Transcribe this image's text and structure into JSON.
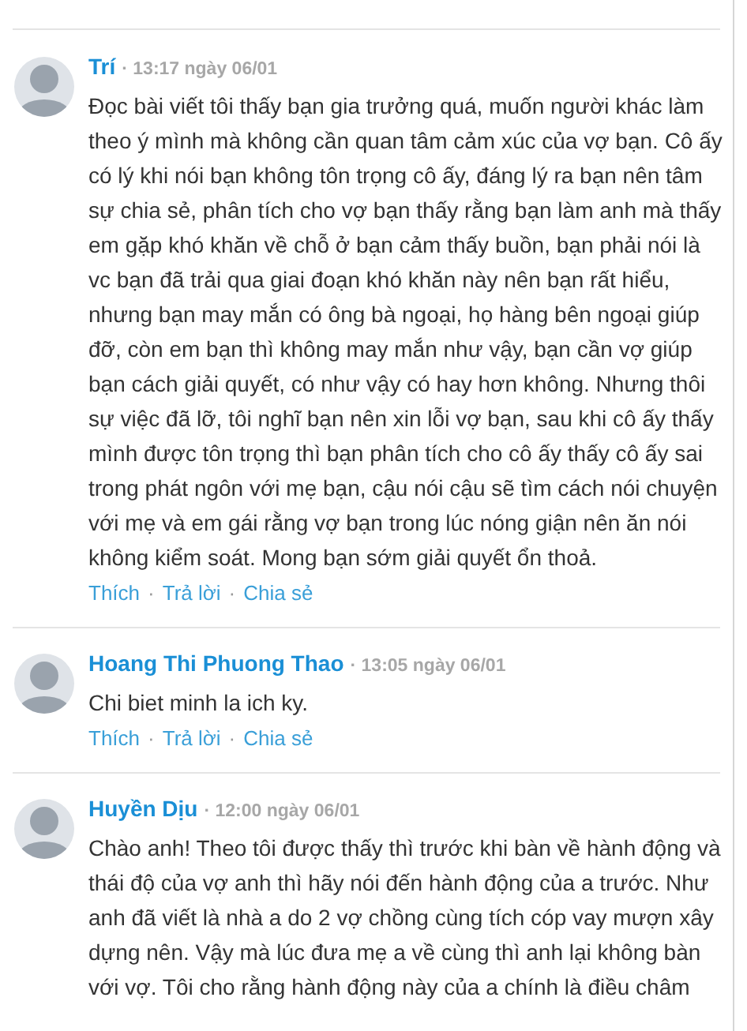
{
  "comments": [
    {
      "author": "Trí",
      "time": "13:17 ngày 06/01",
      "text": "Đọc bài viết tôi thấy bạn gia trưởng quá, muốn người khác làm\ntheo ý mình mà không cần quan tâm cảm xúc của vợ bạn. Cô ấy\ncó lý khi nói bạn không tôn trọng cô ấy, đáng lý ra bạn nên tâm\nsự chia sẻ, phân tích cho vợ bạn thấy rằng bạn làm anh mà thấy\nem gặp khó khăn về chỗ ở bạn cảm thấy buồn, bạn phải nói là\nvc bạn đã trải qua giai đoạn khó khăn này nên bạn rất hiểu,\nnhưng bạn may mắn có ông bà ngoại, họ hàng bên ngoại giúp\nđỡ, còn em bạn thì không may mắn như vậy, bạn cần vợ giúp\nbạn cách giải quyết, có như vậy có hay hơn không. Nhưng thôi\nsự việc đã lỡ, tôi nghĩ bạn nên xin lỗi vợ bạn, sau khi cô ấy thấy\nmình được tôn trọng thì bạn phân tích cho cô ấy thấy cô ấy sai\ntrong phát ngôn với mẹ bạn, cậu nói cậu sẽ tìm cách nói chuyện\nvới mẹ và em gái rằng vợ bạn trong lúc nóng giận nên ăn nói\nkhông kiểm soát. Mong bạn sớm giải quyết ổn thoả.",
      "actions": [
        "Thích",
        "Trả lời",
        "Chia sẻ"
      ]
    },
    {
      "author": "Hoang Thi Phuong Thao",
      "time": "13:05 ngày 06/01",
      "text": "Chi biet minh la ich ky.",
      "actions": [
        "Thích",
        "Trả lời",
        "Chia sẻ"
      ]
    },
    {
      "author": "Huyền Dịu",
      "time": "12:00 ngày 06/01",
      "text": "Chào anh! Theo tôi được thấy thì trước khi bàn về hành động và\nthái độ của vợ anh thì hãy nói đến hành động của a trước. Như\nanh đã viết là nhà a do 2 vợ chồng cùng tích cóp vay mượn xây\ndựng nên. Vậy mà lúc đưa mẹ a về cùng thì anh lại không bàn\nvới vợ. Tôi cho rằng hành động này của a chính là điều châm"
    }
  ],
  "separator": "·"
}
